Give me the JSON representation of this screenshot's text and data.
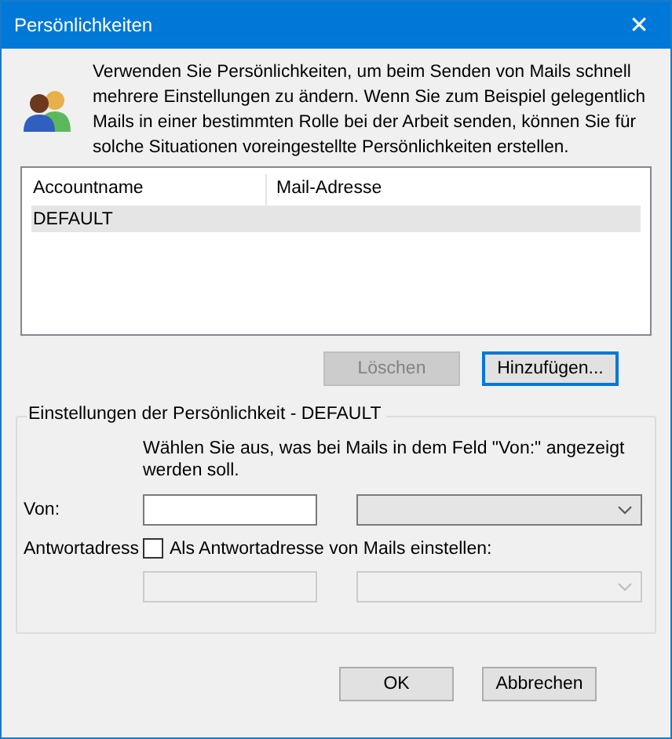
{
  "window": {
    "title": "Persönlichkeiten",
    "close": "✕"
  },
  "intro": "Verwenden Sie Persönlichkeiten, um beim Senden von Mails schnell mehrere Einstellungen zu ändern. Wenn Sie zum Beispiel gelegentlich Mails in einer bestimmten Rolle bei der Arbeit senden, können Sie für solche Situationen voreingestellte Persönlichkeiten erstellen.",
  "table": {
    "columns": [
      "Accountname",
      "Mail-Adresse"
    ],
    "rows": [
      {
        "cells": [
          "DEFAULT"
        ],
        "selected": true
      }
    ]
  },
  "list_buttons": [
    {
      "label": "Löschen",
      "disabled": true,
      "focused": false
    },
    {
      "label": "Hinzufügen...",
      "disabled": false,
      "focused": true
    }
  ],
  "settings": {
    "title": "Einstellungen der Persönlichkeit - DEFAULT",
    "hint": "Wählen Sie aus, was bei Mails in dem Feld \"Von:\" angezeigt werden soll.",
    "from_label": "Von:",
    "from_disabled": false,
    "reply_label": "Antwortadress",
    "reply_checkbox": {
      "label": "Als Antwortadresse von Mails einstellen:",
      "checked": false
    },
    "reply_disabled": true
  },
  "buttons": [
    {
      "label": "OK"
    },
    {
      "label": "Abbrechen"
    }
  ]
}
